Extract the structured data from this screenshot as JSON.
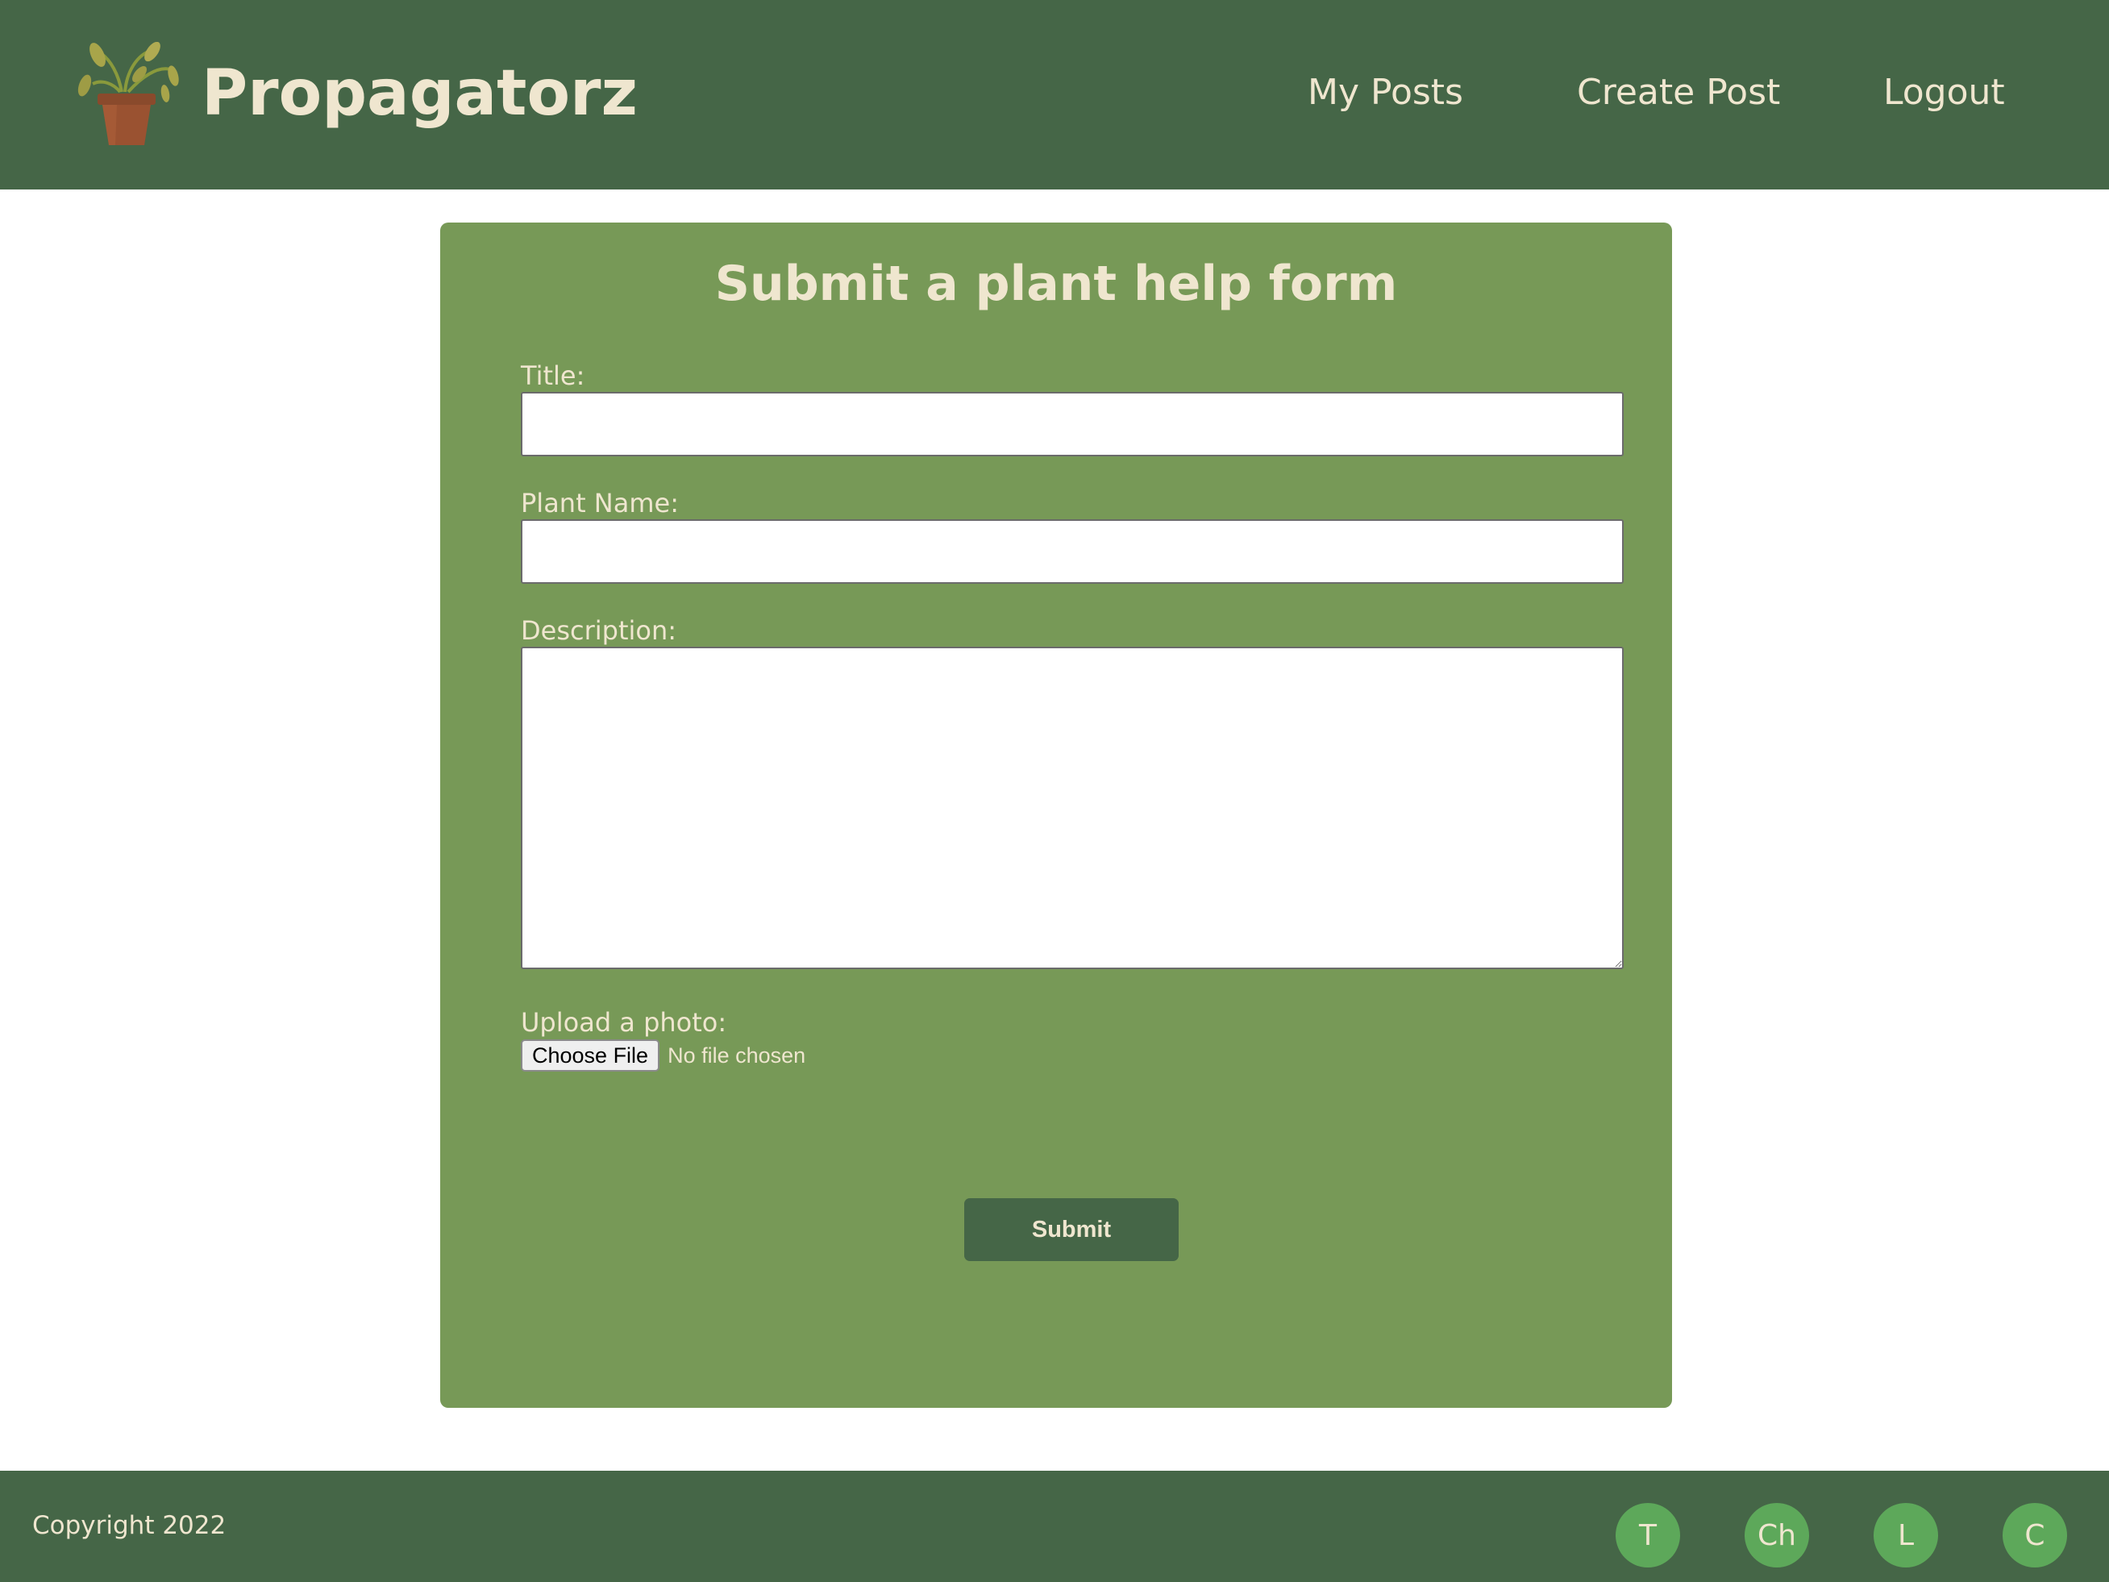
{
  "header": {
    "brand": "Propagatorz",
    "logo_icon": "potted-plant-icon",
    "nav": {
      "my_posts": "My Posts",
      "create_post": "Create Post",
      "logout": "Logout"
    }
  },
  "form": {
    "heading": "Submit a plant help form",
    "title_label": "Title:",
    "title_value": "",
    "plant_name_label": "Plant Name:",
    "plant_name_value": "",
    "description_label": "Description:",
    "description_value": "",
    "upload_label": "Upload a photo:",
    "choose_file_label": "Choose File",
    "file_status": "No file chosen",
    "submit_label": "Submit"
  },
  "footer": {
    "copyright": "Copyright 2022",
    "social": [
      "T",
      "Ch",
      "L",
      "C"
    ]
  },
  "colors": {
    "header_bg": "#456647",
    "card_bg": "#779957",
    "text_cream": "#efe6cf",
    "social_circle": "#5da85a",
    "page_bg": "#ffffff"
  }
}
